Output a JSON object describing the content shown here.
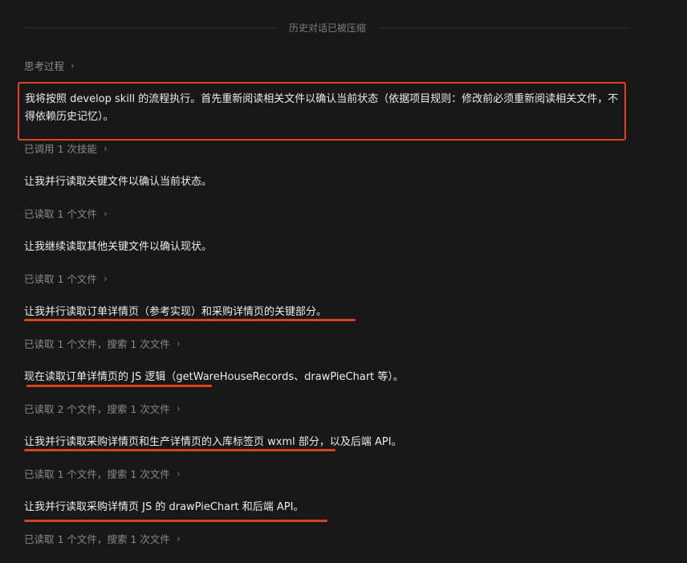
{
  "divider": {
    "label": "历史对话已被压缩"
  },
  "thinking": {
    "label": "思考过程"
  },
  "messages": {
    "m1": "我将按照 develop skill 的流程执行。首先重新阅读相关文件以确认当前状态（依据项目规则：修改前必须重新阅读相关文件，不得依赖历史记忆）。",
    "m2": "让我并行读取关键文件以确认当前状态。",
    "m3": "让我继续读取其他关键文件以确认现状。",
    "m4": "让我并行读取订单详情页（参考实现）和采购详情页的关键部分。",
    "m5": "现在读取订单详情页的 JS 逻辑（getWareHouseRecords、drawPieChart 等）。",
    "m6": "让我并行读取采购详情页和生产详情页的入库标签页 wxml 部分，以及后端 API。",
    "m7": "让我并行读取采购详情页 JS 的 drawPieChart 和后端 API。"
  },
  "tools": {
    "t1": "已调用 1 次技能",
    "t2": "已读取 1 个文件",
    "t3": "已读取 1 个文件",
    "t4": "已读取 1 个文件，搜索 1 次文件",
    "t5": "已读取 2 个文件，搜索 1 次文件",
    "t6": "已读取 1 个文件，搜索 1 次文件",
    "t7": "已读取 1 个文件，搜索 1 次文件"
  },
  "icons": {
    "expand": "›"
  },
  "colors": {
    "background": "#181818",
    "highlight": "#e0412a",
    "underline": "#d9421f",
    "muted_text": "#8a8a8a",
    "main_text": "#ececec"
  }
}
